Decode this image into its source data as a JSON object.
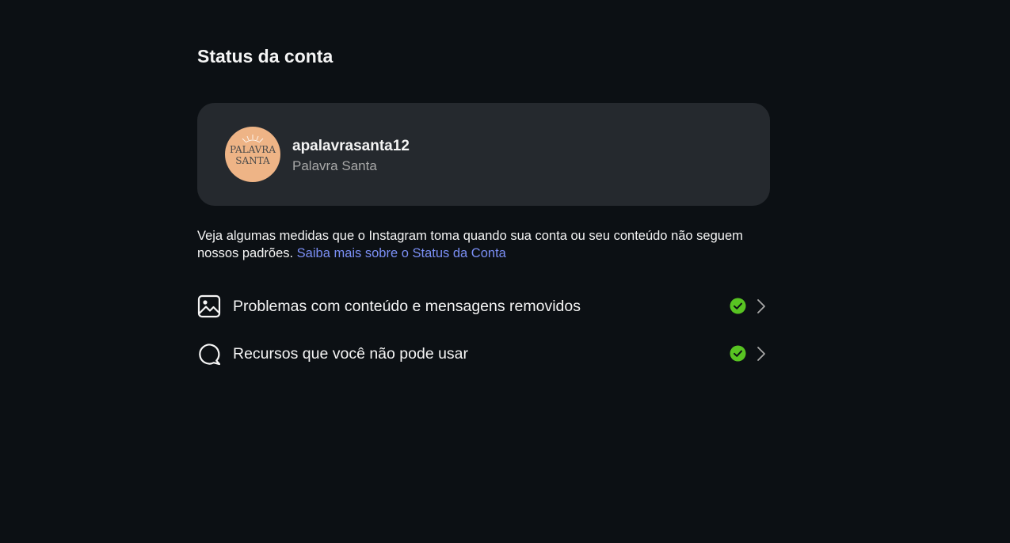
{
  "page": {
    "title": "Status da conta"
  },
  "account": {
    "username": "apalavrasanta12",
    "full_name": "Palavra Santa",
    "avatar": {
      "line1": "PALAVRA",
      "line2": "SANTA",
      "background_color": "#eeb486"
    }
  },
  "description": {
    "text": "Veja algumas medidas que o Instagram toma quando sua conta ou seu conteúdo não seguem nossos padrões.",
    "link_text": "Saiba mais sobre o Status da Conta",
    "link_color": "#7b8ff5"
  },
  "status_items": [
    {
      "icon": "image-icon",
      "label": "Problemas com conteúdo e mensagens removidos",
      "status_icon": "check-circle-icon",
      "status_color": "#58c322"
    },
    {
      "icon": "chat-bubble-icon",
      "label": "Recursos que você não pode usar",
      "status_icon": "check-circle-icon",
      "status_color": "#58c322"
    }
  ]
}
